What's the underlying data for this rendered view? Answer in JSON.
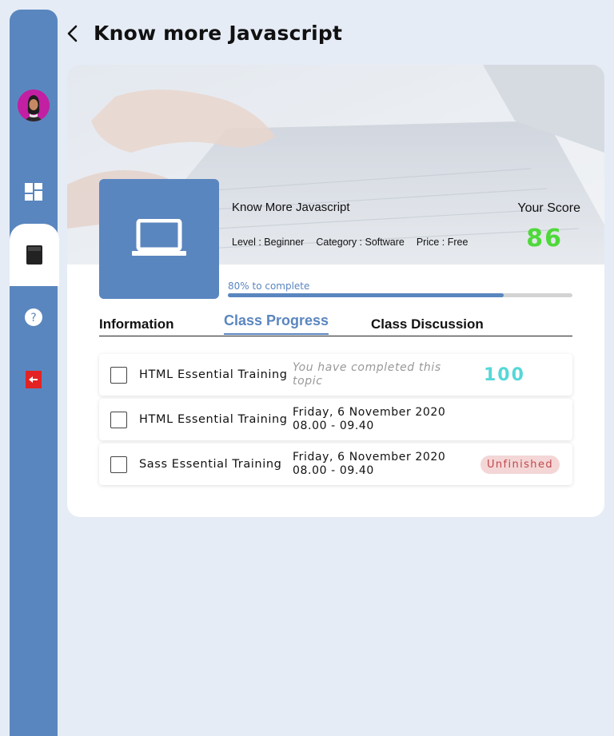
{
  "header": {
    "title": "Know more Javascript"
  },
  "sidebar": {
    "items": [
      {
        "name": "dashboard",
        "icon": "dashboard-icon"
      },
      {
        "name": "courses",
        "icon": "book-icon",
        "active": true
      },
      {
        "name": "help",
        "icon": "help-icon"
      },
      {
        "name": "logout",
        "icon": "logout-icon"
      }
    ]
  },
  "course": {
    "name": "Know More Javascript",
    "level": "Level : Beginner",
    "category": "Category : Software",
    "price": "Price : Free",
    "score_label": "Your Score",
    "score": "86",
    "progress_text": "80% to complete",
    "progress": 0.8
  },
  "tabs": [
    {
      "label": "Information"
    },
    {
      "label": "Class Progress",
      "active": true
    },
    {
      "label": "Class Discussion"
    }
  ],
  "lessons": [
    {
      "title": "HTML Essential Training",
      "info": "You have completed this topic",
      "score": "100"
    },
    {
      "title": "HTML Essential Training",
      "date": "Friday, 6 November 2020",
      "time": "08.00 - 09.40"
    },
    {
      "title": "Sass Essential Training",
      "date": "Friday, 6 November 2020",
      "time": "08.00 - 09.40",
      "status": "Unfinished"
    }
  ],
  "colors": {
    "accent": "#5a86bf",
    "background": "#e6ecf6",
    "score": "#4ed93a",
    "lesson_score": "#57d7d7",
    "badge_bg": "#f4d6d6",
    "badge_text": "#c0484c"
  }
}
